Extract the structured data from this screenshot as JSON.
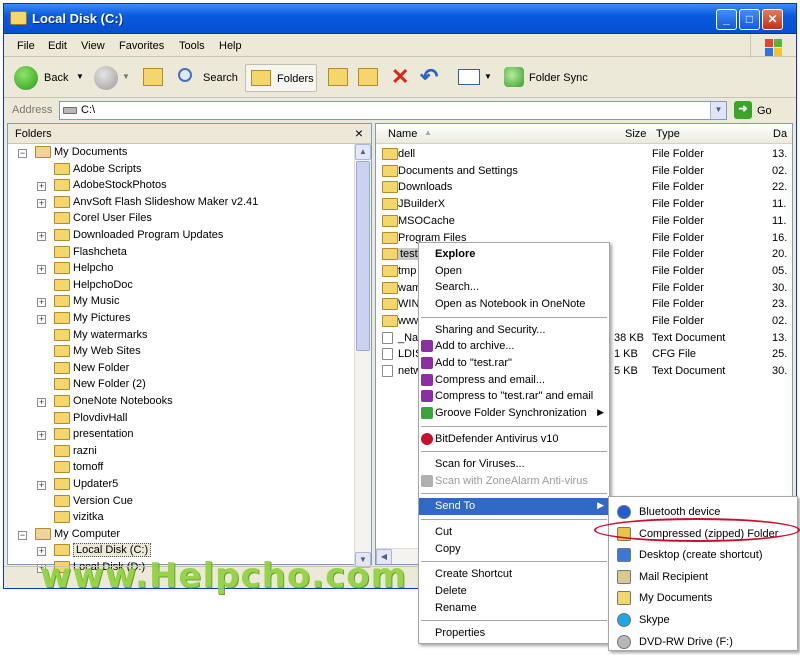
{
  "window": {
    "title": "Local Disk (C:)"
  },
  "menu": [
    "File",
    "Edit",
    "View",
    "Favorites",
    "Tools",
    "Help"
  ],
  "toolbar": {
    "back": "Back",
    "search": "Search",
    "folders": "Folders",
    "folder_sync": "Folder Sync"
  },
  "address": {
    "label": "Address",
    "value": "C:\\",
    "go": "Go"
  },
  "folders_pane": {
    "title": "Folders",
    "close": "×",
    "items": [
      {
        "label": "My Documents",
        "level": 0,
        "exp": "⊟"
      },
      {
        "label": "Adobe Scripts",
        "level": 1,
        "exp": ""
      },
      {
        "label": "AdobeStockPhotos",
        "level": 1,
        "exp": "+"
      },
      {
        "label": "AnvSoft Flash Slideshow Maker v2.41",
        "level": 1,
        "exp": "+"
      },
      {
        "label": "Corel User Files",
        "level": 1,
        "exp": ""
      },
      {
        "label": "Downloaded Program Updates",
        "level": 1,
        "exp": "+"
      },
      {
        "label": "Flashcheta",
        "level": 1,
        "exp": ""
      },
      {
        "label": "Helpcho",
        "level": 1,
        "exp": "+"
      },
      {
        "label": "HelpchoDoc",
        "level": 1,
        "exp": ""
      },
      {
        "label": "My Music",
        "level": 1,
        "exp": "+"
      },
      {
        "label": "My Pictures",
        "level": 1,
        "exp": "+"
      },
      {
        "label": "My watermarks",
        "level": 1,
        "exp": ""
      },
      {
        "label": "My Web Sites",
        "level": 1,
        "exp": ""
      },
      {
        "label": "New Folder",
        "level": 1,
        "exp": ""
      },
      {
        "label": "New Folder (2)",
        "level": 1,
        "exp": ""
      },
      {
        "label": "OneNote Notebooks",
        "level": 1,
        "exp": "+"
      },
      {
        "label": "PlovdivHall",
        "level": 1,
        "exp": ""
      },
      {
        "label": "presentation",
        "level": 1,
        "exp": "+"
      },
      {
        "label": "razni",
        "level": 1,
        "exp": ""
      },
      {
        "label": "tomoff",
        "level": 1,
        "exp": ""
      },
      {
        "label": "Updater5",
        "level": 1,
        "exp": "+"
      },
      {
        "label": "Version Cue",
        "level": 1,
        "exp": ""
      },
      {
        "label": "vizitka",
        "level": 1,
        "exp": ""
      },
      {
        "label": "My Computer",
        "level": 0,
        "exp": "⊟"
      },
      {
        "label": "Local Disk (C:)",
        "level": 1,
        "exp": "+"
      },
      {
        "label": "Local Disk (D:)",
        "level": 1,
        "exp": "+"
      }
    ]
  },
  "files_pane": {
    "columns": {
      "name": "Name",
      "size": "Size",
      "type": "Type",
      "date": "Da"
    },
    "rows": [
      {
        "name": "dell",
        "size": "",
        "type": "File Folder",
        "date": "13."
      },
      {
        "name": "Documents and Settings",
        "size": "",
        "type": "File Folder",
        "date": "02."
      },
      {
        "name": "Downloads",
        "size": "",
        "type": "File Folder",
        "date": "22."
      },
      {
        "name": "JBuilderX",
        "size": "",
        "type": "File Folder",
        "date": "11."
      },
      {
        "name": "MSOCache",
        "size": "",
        "type": "File Folder",
        "date": "11."
      },
      {
        "name": "Program Files",
        "size": "",
        "type": "File Folder",
        "date": "16."
      },
      {
        "name": "test",
        "size": "",
        "type": "File Folder",
        "date": "20."
      },
      {
        "name": "tmp",
        "size": "",
        "type": "File Folder",
        "date": "05."
      },
      {
        "name": "wam",
        "size": "",
        "type": "File Folder",
        "date": "30."
      },
      {
        "name": "WIN",
        "size": "",
        "type": "File Folder",
        "date": "23."
      },
      {
        "name": "www",
        "size": "",
        "type": "File Folder",
        "date": "02."
      },
      {
        "name": "_Nav",
        "size": "38 KB",
        "type": "Text Document",
        "date": "13."
      },
      {
        "name": "LDIS",
        "size": "1 KB",
        "type": "CFG File",
        "date": "25."
      },
      {
        "name": "netw",
        "size": "5 KB",
        "type": "Text Document",
        "date": "30."
      }
    ]
  },
  "context_menu": {
    "items": [
      {
        "label": "Explore",
        "bold": true
      },
      {
        "label": "Open"
      },
      {
        "label": "Search..."
      },
      {
        "label": "Open as Notebook in OneNote"
      },
      {
        "sep": true
      },
      {
        "label": "Sharing and Security..."
      },
      {
        "label": "Add to archive...",
        "icon": "winrar"
      },
      {
        "label": "Add to \"test.rar\"",
        "icon": "winrar"
      },
      {
        "label": "Compress and email...",
        "icon": "winrar"
      },
      {
        "label": "Compress to \"test.rar\" and email",
        "icon": "winrar"
      },
      {
        "label": "Groove Folder Synchronization",
        "icon": "groove",
        "submenu": true
      },
      {
        "sep": true
      },
      {
        "label": "BitDefender Antivirus v10",
        "icon": "bitdefender"
      },
      {
        "sep": true
      },
      {
        "label": "Scan for Viruses..."
      },
      {
        "label": "Scan with ZoneAlarm Anti-virus",
        "icon": "zonealarm",
        "disabled": true
      },
      {
        "sep": true
      },
      {
        "label": "Send To",
        "submenu": true,
        "highlight": true
      },
      {
        "sep": true
      },
      {
        "label": "Cut"
      },
      {
        "label": "Copy"
      },
      {
        "sep": true
      },
      {
        "label": "Create Shortcut"
      },
      {
        "label": "Delete"
      },
      {
        "label": "Rename"
      },
      {
        "sep": true
      },
      {
        "label": "Properties"
      }
    ]
  },
  "send_to_menu": {
    "items": [
      {
        "label": "Bluetooth device",
        "icon": "bluetooth",
        "color": "#1f5fcf"
      },
      {
        "label": "Compressed (zipped) Folder",
        "icon": "zip-folder",
        "color": "#e6c44a",
        "highlight": true
      },
      {
        "label": "Desktop (create shortcut)",
        "icon": "desktop",
        "color": "#3b79d6"
      },
      {
        "label": "Mail Recipient",
        "icon": "mail",
        "color": "#d9c88f"
      },
      {
        "label": "My Documents",
        "icon": "documents-folder",
        "color": "#f5d66c"
      },
      {
        "label": "Skype",
        "icon": "skype",
        "color": "#20a6e6"
      },
      {
        "label": "DVD-RW Drive (F:)",
        "icon": "dvd-drive",
        "color": "#b8b8b8"
      }
    ]
  },
  "watermark": "www.Helpcho.com",
  "colors": {
    "title_blue": "#0a5adf",
    "highlight": "#316ac5",
    "oval_red": "#c8102e",
    "watermark_green": "#8fd23f"
  }
}
